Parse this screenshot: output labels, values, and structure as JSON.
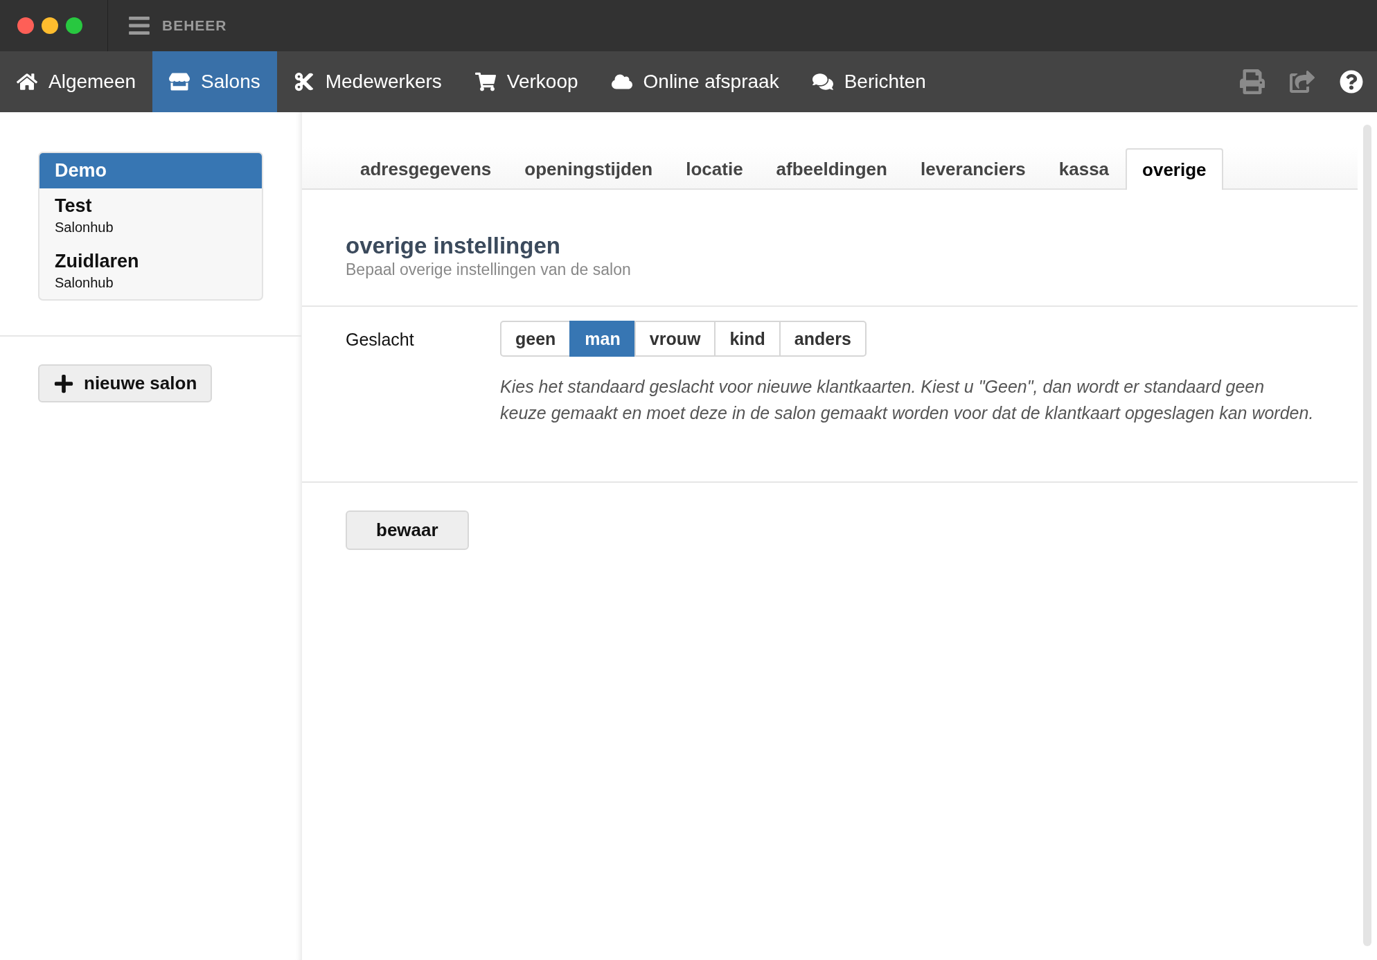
{
  "window": {
    "title": "BEHEER"
  },
  "nav": [
    {
      "label": "Algemeen",
      "selected": false
    },
    {
      "label": "Salons",
      "selected": true
    },
    {
      "label": "Medewerkers",
      "selected": false
    },
    {
      "label": "Verkoop",
      "selected": false
    },
    {
      "label": "Online afspraak",
      "selected": false
    },
    {
      "label": "Berichten",
      "selected": false
    }
  ],
  "sidebar": {
    "items": [
      {
        "name": "Demo",
        "selected": true
      },
      {
        "name": "Test",
        "subtitle": "Salonhub",
        "selected": false
      },
      {
        "name": "Zuidlaren",
        "subtitle": "Salonhub",
        "selected": false
      }
    ],
    "new_button": "nieuwe salon"
  },
  "tabs": [
    {
      "label": "adresgegevens",
      "selected": false
    },
    {
      "label": "openingstijden",
      "selected": false
    },
    {
      "label": "locatie",
      "selected": false
    },
    {
      "label": "afbeeldingen",
      "selected": false
    },
    {
      "label": "leveranciers",
      "selected": false
    },
    {
      "label": "kassa",
      "selected": false
    },
    {
      "label": "overige",
      "selected": true
    }
  ],
  "section": {
    "title": "overige instellingen",
    "subtitle": "Bepaal overige instellingen van de salon"
  },
  "gender": {
    "label": "Geslacht",
    "options": [
      {
        "label": "geen",
        "selected": false
      },
      {
        "label": "man",
        "selected": true
      },
      {
        "label": "vrouw",
        "selected": false
      },
      {
        "label": "kind",
        "selected": false
      },
      {
        "label": "anders",
        "selected": false
      }
    ],
    "help": "Kies het standaard geslacht voor nieuwe klantkaarten. Kiest u \"Geen\", dan wordt er standaard geen keuze gemaakt en moet deze in de salon gemaakt worden voor dat de klantkaart opgeslagen kan worden."
  },
  "save_button": "bewaar"
}
